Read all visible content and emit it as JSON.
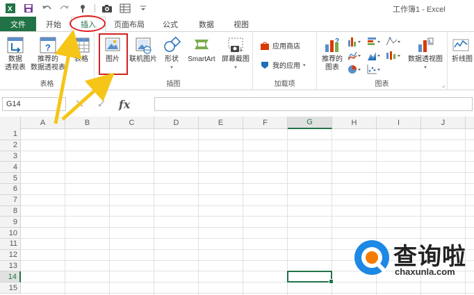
{
  "window_title": "工作簿1 - Excel",
  "qat": {
    "icons": [
      "excel-logo-icon",
      "save-icon",
      "undo-icon",
      "redo-icon",
      "touch-mode-icon",
      "camera-icon",
      "table-icon",
      "customize-icon"
    ]
  },
  "tabs": {
    "file": "文件",
    "home": "开始",
    "insert": "插入",
    "page_layout": "页面布局",
    "formulas": "公式",
    "data": "数据",
    "view": "视图"
  },
  "ribbon": {
    "tables_group": {
      "label": "表格",
      "pivot_table": [
        "数据",
        "透视表"
      ],
      "recommended_pivot": [
        "推荐的",
        "数据透视表"
      ],
      "table": "表格"
    },
    "illustrations_group": {
      "label": "插图",
      "picture": "图片",
      "online_pictures": "联机图片",
      "shapes": "形状",
      "smartart": "SmartArt",
      "screenshot": "屏幕截图"
    },
    "addins_group": {
      "label": "加载项",
      "app_store": "应用商店",
      "my_apps": "我的应用"
    },
    "charts_group": {
      "label": "图表",
      "recommended_charts": [
        "推荐的",
        "图表"
      ],
      "pivot_chart": "数据透视图"
    },
    "sparklines_group": {
      "line": "折线图"
    }
  },
  "formula_bar": {
    "name_box": "G14",
    "fx": "fx",
    "value": ""
  },
  "grid": {
    "columns": [
      "A",
      "B",
      "C",
      "D",
      "E",
      "F",
      "G",
      "H",
      "I",
      "J"
    ],
    "rows": [
      "1",
      "2",
      "3",
      "4",
      "5",
      "6",
      "7",
      "8",
      "9",
      "10",
      "11",
      "12",
      "13",
      "14",
      "15"
    ],
    "selected_column": "G",
    "selected_row": "14"
  },
  "colors": {
    "accent": "#217346",
    "highlight_red": "#e02020",
    "arrow_yellow": "#f5c518"
  },
  "watermark": {
    "text": "查询啦",
    "url": "chaxunla.com"
  }
}
